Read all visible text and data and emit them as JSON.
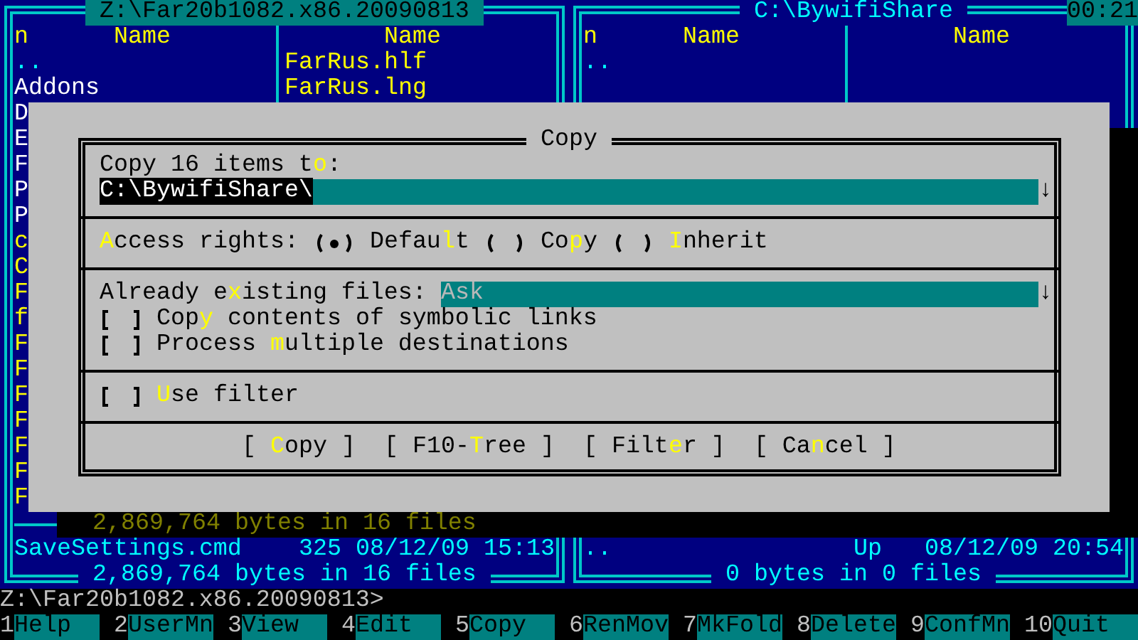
{
  "left_panel": {
    "title": "Z:\\Far20b1082.x86.20090813",
    "columns": [
      "n",
      "Name",
      "Name"
    ],
    "parent_dir": "..",
    "column_1_files": [
      {
        "name": "Addons",
        "kind": "item",
        "selected": false
      },
      {
        "name": "D",
        "kind": "item",
        "selected": false
      },
      {
        "name": "E",
        "kind": "item",
        "selected": false
      },
      {
        "name": "F",
        "kind": "item",
        "selected": false
      },
      {
        "name": "P",
        "kind": "item",
        "selected": false
      },
      {
        "name": "P",
        "kind": "item",
        "selected": false
      },
      {
        "name": "c",
        "kind": "item",
        "selected": true
      },
      {
        "name": "C",
        "kind": "item",
        "selected": true
      },
      {
        "name": "F",
        "kind": "item",
        "selected": true
      },
      {
        "name": "f",
        "kind": "item",
        "selected": true
      },
      {
        "name": "F",
        "kind": "item",
        "selected": true
      },
      {
        "name": "F",
        "kind": "item",
        "selected": true
      },
      {
        "name": "F",
        "kind": "item",
        "selected": true
      },
      {
        "name": "F",
        "kind": "item",
        "selected": true
      },
      {
        "name": "F",
        "kind": "item",
        "selected": true
      },
      {
        "name": "F",
        "kind": "item",
        "selected": true
      },
      {
        "name": "F",
        "kind": "item",
        "selected": true
      }
    ],
    "column_2_files": [
      {
        "name": "FarRus.hlf",
        "kind": "item",
        "selected": true
      },
      {
        "name": "FarRus.lng",
        "kind": "item",
        "selected": true
      }
    ],
    "selection_summary": "2,869,764 bytes in 16 files",
    "info": {
      "name": "SaveSettings.cmd",
      "size": "325",
      "date": "08/12/09",
      "time": "15:13"
    },
    "totals": "2,869,764 bytes in 16 files"
  },
  "right_panel": {
    "title": "C:\\BywifiShare",
    "columns": [
      "n",
      "Name",
      "Name"
    ],
    "parent_dir": "..",
    "info": {
      "name": "..",
      "size": "Up",
      "date": "08/12/09",
      "time": "20:54"
    },
    "totals": "0 bytes in 0 files"
  },
  "clock": "00:21",
  "copy_dialog": {
    "title": "Copy",
    "destination_label": "Copy 16 items t**o**:",
    "destination": {
      "value": "C:\\BywifiShare\\",
      "value_selected": true,
      "history_arrow": "↓"
    },
    "access_rights": {
      "label": "**A**ccess rights:",
      "options": [
        {
          "label": "Defau**l**t",
          "selected": true
        },
        {
          "label": "Co**p**y",
          "selected": false
        },
        {
          "label": "**I**nherit",
          "selected": false
        }
      ]
    },
    "existing_files": {
      "label": "Already e**x**isting files:",
      "value": "Ask",
      "disabled": true,
      "arrow": "↓"
    },
    "checkboxes": [
      {
        "label": "Cop**y** contents of symbolic links",
        "checked": false
      },
      {
        "label": "Process **m**ultiple destinations",
        "checked": false
      }
    ],
    "filter_checkbox": {
      "label": "**U**se filter",
      "checked": false
    },
    "buttons": [
      "[ **C**opy ]",
      "[ F10-**T**ree ]",
      "[ Filt**e**r ]",
      "[ Ca**n**cel ]"
    ]
  },
  "command_line": "Z:\\Far20b1082.x86.20090813>",
  "key_bar": [
    {
      "number": "1",
      "label": "Help"
    },
    {
      "number": "2",
      "label": "UserMn"
    },
    {
      "number": "3",
      "label": "View"
    },
    {
      "number": "4",
      "label": "Edit"
    },
    {
      "number": "5",
      "label": "Copy"
    },
    {
      "number": "6",
      "label": "RenMov"
    },
    {
      "number": "7",
      "label": "MkFold"
    },
    {
      "number": "8",
      "label": "Delete"
    },
    {
      "number": "9",
      "label": "ConfMn"
    },
    {
      "number": "10",
      "label": "Quit"
    }
  ]
}
